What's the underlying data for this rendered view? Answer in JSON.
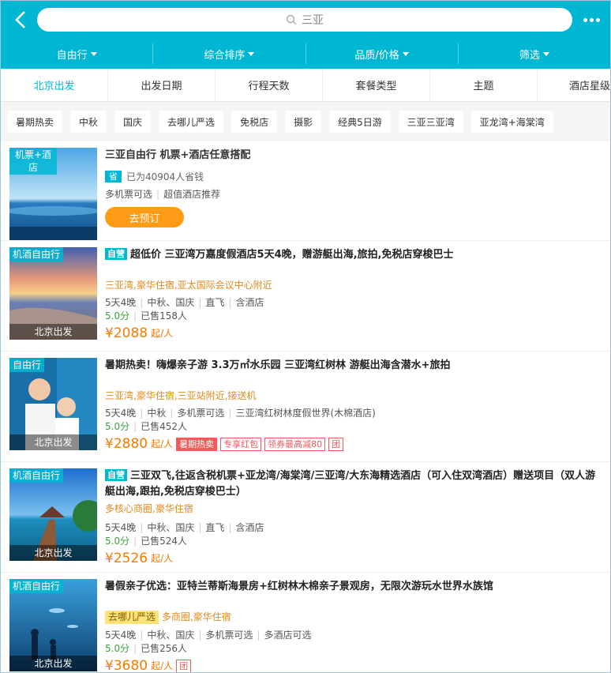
{
  "header": {
    "search_text": "三亚"
  },
  "filters": [
    "自由行",
    "综合排序",
    "品质/价格",
    "筛选"
  ],
  "tabs": [
    "北京出发",
    "出发日期",
    "行程天数",
    "套餐类型",
    "主题",
    "酒店星级"
  ],
  "chips": [
    "暑期热卖",
    "中秋",
    "国庆",
    "去哪儿严选",
    "免税店",
    "摄影",
    "经典5日游",
    "三亚三亚湾",
    "亚龙湾+海棠湾"
  ],
  "featured": {
    "tag": "机票+酒店",
    "title": "三亚自由行 机票+酒店任意搭配",
    "save_badge": "省",
    "save_text": "已为40904人省钱",
    "desc": [
      "多机票可选",
      "超值酒店推荐"
    ],
    "button": "去预订"
  },
  "items": [
    {
      "tag": "机酒自由行",
      "bottom": "北京出发",
      "badge": "自营",
      "title": "超低价 三亚湾万嘉度假酒店5天4晚，赠游艇出海,旅拍,免税店穿梭巴士",
      "location": "三亚湾,豪华住宿,亚太国际会议中心附近",
      "meta": [
        "5天4晚",
        "中秋、国庆",
        "直飞",
        "含酒店"
      ],
      "score": "5.0分",
      "sold": "已售158人",
      "price": "¥2088",
      "price_suffix": "起/人"
    },
    {
      "tag": "自由行",
      "bottom": "北京出发",
      "title": "暑期热卖！嗨爆亲子游 3.3万㎡水乐园 三亚湾红树林 游艇出海含潜水+旅拍",
      "location": "三亚湾,豪华住宿,三亚站附近,接送机",
      "meta": [
        "5天4晚",
        "中秋",
        "多机票可选",
        "三亚湾红树林度假世界(木棉酒店)"
      ],
      "score": "5.0分",
      "sold": "已售452人",
      "price": "¥2880",
      "price_suffix": "起/人",
      "tags": [
        "暑期热卖",
        "专享红包",
        "领券最高减80",
        "团"
      ]
    },
    {
      "tag": "机酒自由行",
      "bottom": "北京出发",
      "badge": "自营",
      "title": "三亚双飞,往返含税机票+亚龙湾/海棠湾/三亚湾/大东海精选酒店（可入住双湾酒店）赠送项目（双人游艇出海,跟拍,免税店穿梭巴士）",
      "location": "多核心商圈,豪华住宿",
      "meta": [
        "5天4晚",
        "中秋、国庆",
        "直飞",
        "含酒店"
      ],
      "score": "5.0分",
      "sold": "已售524人",
      "price": "¥2526",
      "price_suffix": "起/人"
    },
    {
      "tag": "机酒自由行",
      "bottom": "北京出发",
      "title": "暑假亲子优选：亚特兰蒂斯海景房+红树林木棉亲子景观房，无限次游玩水世界水族馆",
      "qunar": "去哪儿严选",
      "location": "多商圈,豪华住宿",
      "meta": [
        "5天4晚",
        "中秋、国庆",
        "多机票可选",
        "多酒店可选"
      ],
      "score": "5.0分",
      "sold": "已售256人",
      "price": "¥3680",
      "price_suffix": "起/人",
      "tags": [
        "团"
      ]
    }
  ]
}
